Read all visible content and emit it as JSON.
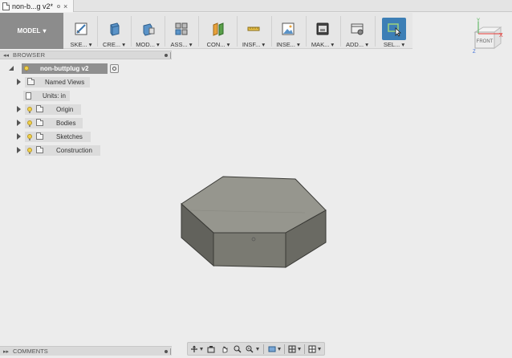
{
  "tab": {
    "title": "non-b...g v2*",
    "close": "×"
  },
  "toolbar": {
    "workspace": "MODEL",
    "tools": [
      {
        "label": "SKE...",
        "icon": "sketch-icon"
      },
      {
        "label": "CRE...",
        "icon": "create-icon"
      },
      {
        "label": "MOD...",
        "icon": "modify-icon"
      },
      {
        "label": "ASS...",
        "icon": "assemble-icon"
      },
      {
        "label": "CON...",
        "icon": "construct-icon"
      },
      {
        "label": "INSF...",
        "icon": "inspect-icon"
      },
      {
        "label": "INSE...",
        "icon": "insert-icon"
      },
      {
        "label": "MAK...",
        "icon": "make-icon"
      },
      {
        "label": "ADD...",
        "icon": "addins-icon"
      },
      {
        "label": "SEL...",
        "icon": "select-icon",
        "active": true
      }
    ],
    "accent": "#3d7fb6"
  },
  "viewcube": {
    "face": "FRONT",
    "axis_x": "X",
    "axis_y": "Y",
    "axis_z": "Z"
  },
  "browser": {
    "title": "BROWSER",
    "root": "non-buttplug v2",
    "items": [
      {
        "label": "Named Views"
      },
      {
        "label": "Units: in"
      },
      {
        "label": "Origin"
      },
      {
        "label": "Bodies"
      },
      {
        "label": "Sketches"
      },
      {
        "label": "Construction"
      }
    ]
  },
  "comments": {
    "title": "COMMENTS"
  },
  "navbar": {
    "items": [
      "orbit-icon",
      "look-at-icon",
      "pan-icon",
      "zoom-icon",
      "zoom-window-icon",
      "display-settings-icon",
      "grid-icon",
      "viewports-icon"
    ]
  },
  "model": {
    "face_color": "#7a7a72",
    "top_color": "#96968e"
  }
}
